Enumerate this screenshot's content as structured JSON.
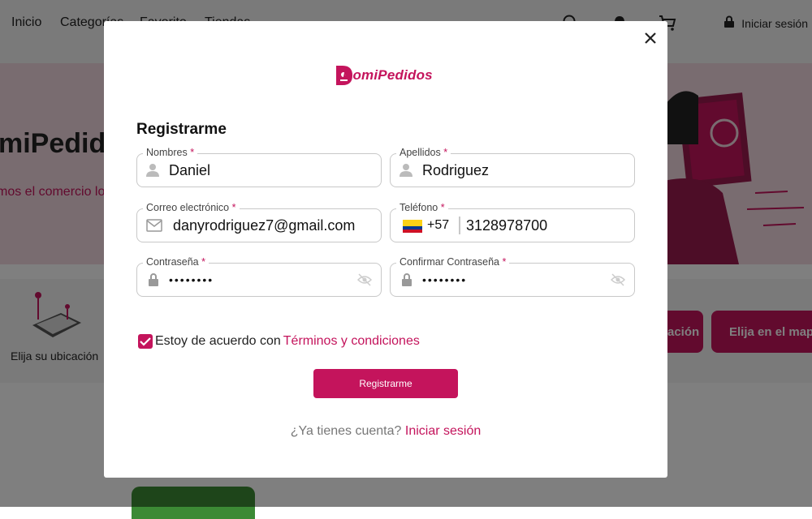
{
  "nav": {
    "links": [
      "Inicio",
      "Categorías",
      "Favorito",
      "Tiendas"
    ],
    "signin": "Iniciar sesión",
    "icons": [
      "search-icon",
      "bell-icon",
      "cart-icon",
      "lock-icon"
    ]
  },
  "hero": {
    "title": "miPedido",
    "subtitle": "mos el comercio lo"
  },
  "strip": {
    "location_label": "Elija su ubicación",
    "button_1": "ación",
    "button_2": "Elija en el map"
  },
  "modal": {
    "logo": "DomiPedidos",
    "title": "Registrarme",
    "fields": {
      "nombres": {
        "label": "Nombres",
        "value": "Daniel",
        "icon": "person-icon"
      },
      "apellidos": {
        "label": "Apellidos",
        "value": "Rodriguez",
        "icon": "person-icon"
      },
      "correo": {
        "label": "Correo electrónico",
        "value": "danyrodriguez7@gmail.com",
        "icon": "mail-icon"
      },
      "telefono": {
        "label": "Teléfono",
        "dial_code": "+57",
        "value": "3128978700",
        "flag": "colombia-flag"
      },
      "contrasena": {
        "label": "Contraseña",
        "value": "••••••••",
        "icon": "lock-icon"
      },
      "confirmar": {
        "label": "Confirmar Contraseña",
        "value": "••••••••",
        "icon": "lock-icon"
      }
    },
    "required_mark": "*",
    "terms_text": "Estoy de acuerdo con",
    "terms_link": "Términos y condiciones",
    "terms_checked": true,
    "submit": "Registrarme",
    "login_prompt": "¿Ya tienes cuenta?",
    "login_link": "Iniciar sesión"
  },
  "colors": {
    "brand": "#c4145c",
    "overlay": "rgba(0,0,0,0.5)"
  }
}
